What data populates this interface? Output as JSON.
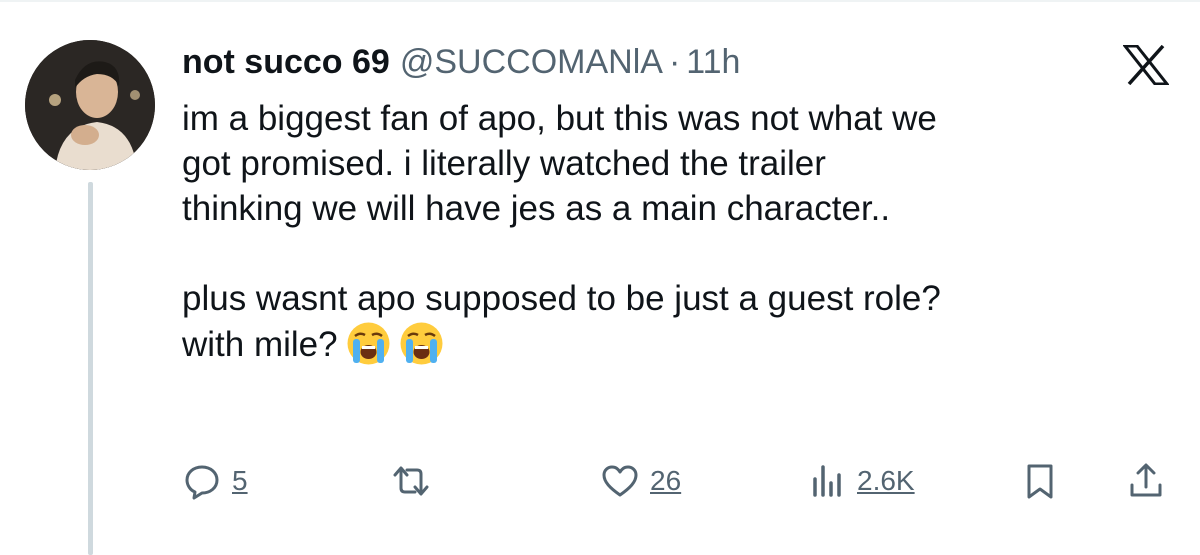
{
  "tweet": {
    "display_name": "not succo 69",
    "handle": "@SUCCOMANlA",
    "separator": "·",
    "time": "11h",
    "body_line1": "im a biggest fan of apo, but this was not what we\ngot promised. i literally watched the trailer\nthinking we will have jes as a main character..\n\nplus wasnt apo supposed to be just a guest role?\nwith mile?",
    "emoji_1": "loudly-crying-face",
    "emoji_2": "loudly-crying-face"
  },
  "actions": {
    "reply_count": "5",
    "like_count": "26",
    "views_count": "2.6K"
  },
  "icons": [
    "reply-icon",
    "retweet-icon",
    "like-icon",
    "views-icon",
    "bookmark-icon",
    "share-icon",
    "x-logo-icon"
  ],
  "colors": {
    "secondary": "#536471",
    "thread_line": "#cfd9de",
    "text": "#0f1419"
  }
}
